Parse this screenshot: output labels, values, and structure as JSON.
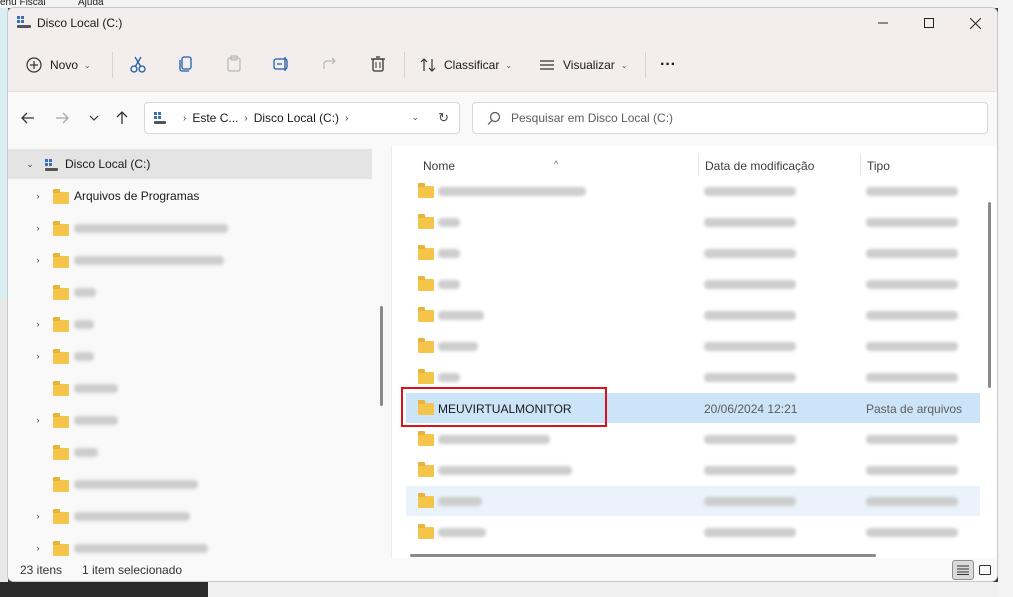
{
  "background": {
    "menu_items": [
      "enu Fiscal",
      "Ajuda"
    ]
  },
  "window": {
    "title": "Disco Local (C:)"
  },
  "toolbar": {
    "new_label": "Novo",
    "sort_label": "Classificar",
    "view_label": "Visualizar",
    "more_label": "···"
  },
  "address_bar": {
    "crumbs": [
      "Este C...",
      "Disco Local (C:)"
    ],
    "search_placeholder": "Pesquisar em Disco Local (C:)"
  },
  "nav_pane": {
    "root_label": "Disco Local (C:)",
    "items": [
      {
        "label": "Arquivos de Programas",
        "expandable": true
      }
    ]
  },
  "file_list": {
    "columns": {
      "name": "Nome",
      "date": "Data de modificação",
      "type": "Tipo"
    },
    "selected_row": {
      "name": "MEUVIRTUALMONITOR",
      "date": "20/06/2024 12:21",
      "type": "Pasta de arquivos"
    }
  },
  "status": {
    "item_count": "23 itens",
    "selection": "1 item selecionado"
  },
  "colors": {
    "selection": "#cce4f7",
    "highlight_border": "#d8141a",
    "folder": "#f5c54a"
  }
}
